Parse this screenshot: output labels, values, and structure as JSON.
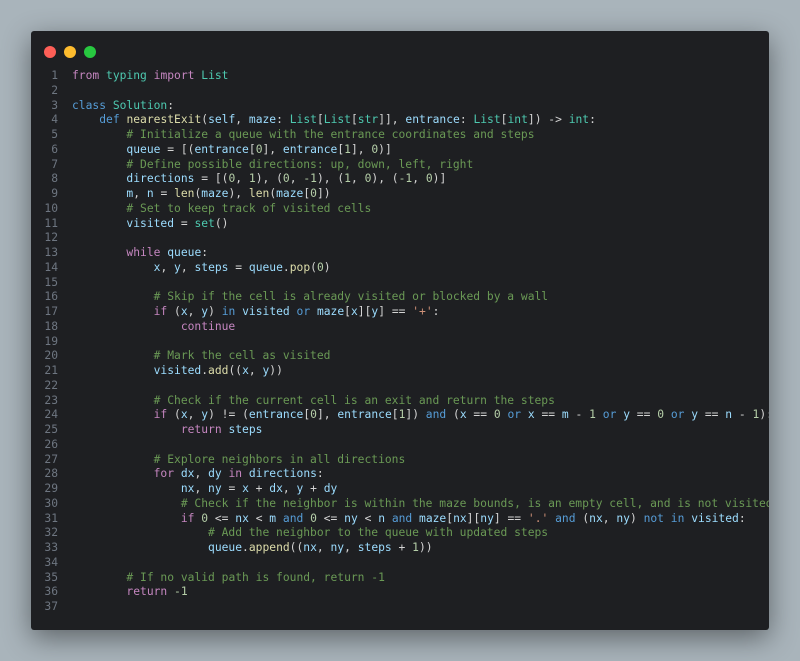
{
  "window": {
    "controls": [
      "close",
      "minimize",
      "maximize"
    ],
    "colors": {
      "close": "#fe5f57",
      "minimize": "#febc2e",
      "maximize": "#28c840",
      "background": "#1e1f22"
    }
  },
  "editor": {
    "language": "python",
    "lines": [
      {
        "n": "1",
        "t": [
          [
            "k",
            "from"
          ],
          [
            "p",
            " "
          ],
          [
            "c",
            "typing"
          ],
          [
            "p",
            " "
          ],
          [
            "k",
            "import"
          ],
          [
            "p",
            " "
          ],
          [
            "c",
            "List"
          ]
        ]
      },
      {
        "n": "2",
        "t": []
      },
      {
        "n": "3",
        "t": [
          [
            "d",
            "class"
          ],
          [
            "p",
            " "
          ],
          [
            "c",
            "Solution"
          ],
          [
            "p",
            ":"
          ]
        ]
      },
      {
        "n": "4",
        "t": [
          [
            "p",
            "    "
          ],
          [
            "d",
            "def"
          ],
          [
            "p",
            " "
          ],
          [
            "f",
            "nearestExit"
          ],
          [
            "p",
            "("
          ],
          [
            "v",
            "self"
          ],
          [
            "p",
            ", "
          ],
          [
            "v",
            "maze"
          ],
          [
            "p",
            ": "
          ],
          [
            "c",
            "List"
          ],
          [
            "p",
            "["
          ],
          [
            "c",
            "List"
          ],
          [
            "p",
            "["
          ],
          [
            "c",
            "str"
          ],
          [
            "p",
            "]], "
          ],
          [
            "v",
            "entrance"
          ],
          [
            "p",
            ": "
          ],
          [
            "c",
            "List"
          ],
          [
            "p",
            "["
          ],
          [
            "c",
            "int"
          ],
          [
            "p",
            "]) -> "
          ],
          [
            "c",
            "int"
          ],
          [
            "p",
            ":"
          ]
        ]
      },
      {
        "n": "5",
        "t": [
          [
            "p",
            "        "
          ],
          [
            "cm",
            "# Initialize a queue with the entrance coordinates and steps"
          ]
        ]
      },
      {
        "n": "6",
        "t": [
          [
            "p",
            "        "
          ],
          [
            "v",
            "queue"
          ],
          [
            "p",
            " = [("
          ],
          [
            "v",
            "entrance"
          ],
          [
            "p",
            "["
          ],
          [
            "n",
            "0"
          ],
          [
            "p",
            "], "
          ],
          [
            "v",
            "entrance"
          ],
          [
            "p",
            "["
          ],
          [
            "n",
            "1"
          ],
          [
            "p",
            "], "
          ],
          [
            "n",
            "0"
          ],
          [
            "p",
            ")]"
          ]
        ]
      },
      {
        "n": "7",
        "t": [
          [
            "p",
            "        "
          ],
          [
            "cm",
            "# Define possible directions: up, down, left, right"
          ]
        ]
      },
      {
        "n": "8",
        "t": [
          [
            "p",
            "        "
          ],
          [
            "v",
            "directions"
          ],
          [
            "p",
            " = [("
          ],
          [
            "n",
            "0"
          ],
          [
            "p",
            ", "
          ],
          [
            "n",
            "1"
          ],
          [
            "p",
            "), ("
          ],
          [
            "n",
            "0"
          ],
          [
            "p",
            ", "
          ],
          [
            "n",
            "-1"
          ],
          [
            "p",
            "), ("
          ],
          [
            "n",
            "1"
          ],
          [
            "p",
            ", "
          ],
          [
            "n",
            "0"
          ],
          [
            "p",
            "), ("
          ],
          [
            "n",
            "-1"
          ],
          [
            "p",
            ", "
          ],
          [
            "n",
            "0"
          ],
          [
            "p",
            ")]"
          ]
        ]
      },
      {
        "n": "9",
        "t": [
          [
            "p",
            "        "
          ],
          [
            "v",
            "m"
          ],
          [
            "p",
            ", "
          ],
          [
            "v",
            "n"
          ],
          [
            "p",
            " = "
          ],
          [
            "f",
            "len"
          ],
          [
            "p",
            "("
          ],
          [
            "v",
            "maze"
          ],
          [
            "p",
            "), "
          ],
          [
            "f",
            "len"
          ],
          [
            "p",
            "("
          ],
          [
            "v",
            "maze"
          ],
          [
            "p",
            "["
          ],
          [
            "n",
            "0"
          ],
          [
            "p",
            "])"
          ]
        ]
      },
      {
        "n": "10",
        "t": [
          [
            "p",
            "        "
          ],
          [
            "cm",
            "# Set to keep track of visited cells"
          ]
        ]
      },
      {
        "n": "11",
        "t": [
          [
            "p",
            "        "
          ],
          [
            "v",
            "visited"
          ],
          [
            "p",
            " = "
          ],
          [
            "c",
            "set"
          ],
          [
            "p",
            "()"
          ]
        ]
      },
      {
        "n": "12",
        "t": []
      },
      {
        "n": "13",
        "t": [
          [
            "p",
            "        "
          ],
          [
            "k",
            "while"
          ],
          [
            "p",
            " "
          ],
          [
            "v",
            "queue"
          ],
          [
            "p",
            ":"
          ]
        ]
      },
      {
        "n": "14",
        "t": [
          [
            "p",
            "            "
          ],
          [
            "v",
            "x"
          ],
          [
            "p",
            ", "
          ],
          [
            "v",
            "y"
          ],
          [
            "p",
            ", "
          ],
          [
            "v",
            "steps"
          ],
          [
            "p",
            " = "
          ],
          [
            "v",
            "queue"
          ],
          [
            "p",
            "."
          ],
          [
            "f",
            "pop"
          ],
          [
            "p",
            "("
          ],
          [
            "n",
            "0"
          ],
          [
            "p",
            ")"
          ]
        ]
      },
      {
        "n": "15",
        "t": []
      },
      {
        "n": "16",
        "t": [
          [
            "p",
            "            "
          ],
          [
            "cm",
            "# Skip if the cell is already visited or blocked by a wall"
          ]
        ]
      },
      {
        "n": "17",
        "t": [
          [
            "p",
            "            "
          ],
          [
            "k",
            "if"
          ],
          [
            "p",
            " ("
          ],
          [
            "v",
            "x"
          ],
          [
            "p",
            ", "
          ],
          [
            "v",
            "y"
          ],
          [
            "p",
            ") "
          ],
          [
            "d",
            "in"
          ],
          [
            "p",
            " "
          ],
          [
            "v",
            "visited"
          ],
          [
            "p",
            " "
          ],
          [
            "d",
            "or"
          ],
          [
            "p",
            " "
          ],
          [
            "v",
            "maze"
          ],
          [
            "p",
            "["
          ],
          [
            "v",
            "x"
          ],
          [
            "p",
            "]["
          ],
          [
            "v",
            "y"
          ],
          [
            "p",
            "] == "
          ],
          [
            "s",
            "'+'"
          ],
          [
            "p",
            ":"
          ]
        ]
      },
      {
        "n": "18",
        "t": [
          [
            "p",
            "                "
          ],
          [
            "k",
            "continue"
          ]
        ]
      },
      {
        "n": "19",
        "t": []
      },
      {
        "n": "20",
        "t": [
          [
            "p",
            "            "
          ],
          [
            "cm",
            "# Mark the cell as visited"
          ]
        ]
      },
      {
        "n": "21",
        "t": [
          [
            "p",
            "            "
          ],
          [
            "v",
            "visited"
          ],
          [
            "p",
            "."
          ],
          [
            "f",
            "add"
          ],
          [
            "p",
            "(("
          ],
          [
            "v",
            "x"
          ],
          [
            "p",
            ", "
          ],
          [
            "v",
            "y"
          ],
          [
            "p",
            "))"
          ]
        ]
      },
      {
        "n": "22",
        "t": []
      },
      {
        "n": "23",
        "t": [
          [
            "p",
            "            "
          ],
          [
            "cm",
            "# Check if the current cell is an exit and return the steps"
          ]
        ]
      },
      {
        "n": "24",
        "t": [
          [
            "p",
            "            "
          ],
          [
            "k",
            "if"
          ],
          [
            "p",
            " ("
          ],
          [
            "v",
            "x"
          ],
          [
            "p",
            ", "
          ],
          [
            "v",
            "y"
          ],
          [
            "p",
            ") != ("
          ],
          [
            "v",
            "entrance"
          ],
          [
            "p",
            "["
          ],
          [
            "n",
            "0"
          ],
          [
            "p",
            "], "
          ],
          [
            "v",
            "entrance"
          ],
          [
            "p",
            "["
          ],
          [
            "n",
            "1"
          ],
          [
            "p",
            "]) "
          ],
          [
            "d",
            "and"
          ],
          [
            "p",
            " ("
          ],
          [
            "v",
            "x"
          ],
          [
            "p",
            " == "
          ],
          [
            "n",
            "0"
          ],
          [
            "p",
            " "
          ],
          [
            "d",
            "or"
          ],
          [
            "p",
            " "
          ],
          [
            "v",
            "x"
          ],
          [
            "p",
            " == "
          ],
          [
            "v",
            "m"
          ],
          [
            "p",
            " - "
          ],
          [
            "n",
            "1"
          ],
          [
            "p",
            " "
          ],
          [
            "d",
            "or"
          ],
          [
            "p",
            " "
          ],
          [
            "v",
            "y"
          ],
          [
            "p",
            " == "
          ],
          [
            "n",
            "0"
          ],
          [
            "p",
            " "
          ],
          [
            "d",
            "or"
          ],
          [
            "p",
            " "
          ],
          [
            "v",
            "y"
          ],
          [
            "p",
            " == "
          ],
          [
            "v",
            "n"
          ],
          [
            "p",
            " - "
          ],
          [
            "n",
            "1"
          ],
          [
            "p",
            "):"
          ]
        ]
      },
      {
        "n": "25",
        "t": [
          [
            "p",
            "                "
          ],
          [
            "k",
            "return"
          ],
          [
            "p",
            " "
          ],
          [
            "v",
            "steps"
          ]
        ]
      },
      {
        "n": "26",
        "t": []
      },
      {
        "n": "27",
        "t": [
          [
            "p",
            "            "
          ],
          [
            "cm",
            "# Explore neighbors in all directions"
          ]
        ]
      },
      {
        "n": "28",
        "t": [
          [
            "p",
            "            "
          ],
          [
            "k",
            "for"
          ],
          [
            "p",
            " "
          ],
          [
            "v",
            "dx"
          ],
          [
            "p",
            ", "
          ],
          [
            "v",
            "dy"
          ],
          [
            "p",
            " "
          ],
          [
            "k",
            "in"
          ],
          [
            "p",
            " "
          ],
          [
            "v",
            "directions"
          ],
          [
            "p",
            ":"
          ]
        ]
      },
      {
        "n": "29",
        "t": [
          [
            "p",
            "                "
          ],
          [
            "v",
            "nx"
          ],
          [
            "p",
            ", "
          ],
          [
            "v",
            "ny"
          ],
          [
            "p",
            " = "
          ],
          [
            "v",
            "x"
          ],
          [
            "p",
            " + "
          ],
          [
            "v",
            "dx"
          ],
          [
            "p",
            ", "
          ],
          [
            "v",
            "y"
          ],
          [
            "p",
            " + "
          ],
          [
            "v",
            "dy"
          ]
        ]
      },
      {
        "n": "30",
        "t": [
          [
            "p",
            "                "
          ],
          [
            "cm",
            "# Check if the neighbor is within the maze bounds, is an empty cell, and is not visited"
          ]
        ]
      },
      {
        "n": "31",
        "t": [
          [
            "p",
            "                "
          ],
          [
            "k",
            "if"
          ],
          [
            "p",
            " "
          ],
          [
            "n",
            "0"
          ],
          [
            "p",
            " <= "
          ],
          [
            "v",
            "nx"
          ],
          [
            "p",
            " < "
          ],
          [
            "v",
            "m"
          ],
          [
            "p",
            " "
          ],
          [
            "d",
            "and"
          ],
          [
            "p",
            " "
          ],
          [
            "n",
            "0"
          ],
          [
            "p",
            " <= "
          ],
          [
            "v",
            "ny"
          ],
          [
            "p",
            " < "
          ],
          [
            "v",
            "n"
          ],
          [
            "p",
            " "
          ],
          [
            "d",
            "and"
          ],
          [
            "p",
            " "
          ],
          [
            "v",
            "maze"
          ],
          [
            "p",
            "["
          ],
          [
            "v",
            "nx"
          ],
          [
            "p",
            "]["
          ],
          [
            "v",
            "ny"
          ],
          [
            "p",
            "] == "
          ],
          [
            "s",
            "'.'"
          ],
          [
            "p",
            " "
          ],
          [
            "d",
            "and"
          ],
          [
            "p",
            " ("
          ],
          [
            "v",
            "nx"
          ],
          [
            "p",
            ", "
          ],
          [
            "v",
            "ny"
          ],
          [
            "p",
            ") "
          ],
          [
            "d",
            "not"
          ],
          [
            "p",
            " "
          ],
          [
            "d",
            "in"
          ],
          [
            "p",
            " "
          ],
          [
            "v",
            "visited"
          ],
          [
            "p",
            ":"
          ]
        ]
      },
      {
        "n": "32",
        "t": [
          [
            "p",
            "                    "
          ],
          [
            "cm",
            "# Add the neighbor to the queue with updated steps"
          ]
        ]
      },
      {
        "n": "33",
        "t": [
          [
            "p",
            "                    "
          ],
          [
            "v",
            "queue"
          ],
          [
            "p",
            "."
          ],
          [
            "f",
            "append"
          ],
          [
            "p",
            "(("
          ],
          [
            "v",
            "nx"
          ],
          [
            "p",
            ", "
          ],
          [
            "v",
            "ny"
          ],
          [
            "p",
            ", "
          ],
          [
            "v",
            "steps"
          ],
          [
            "p",
            " + "
          ],
          [
            "n",
            "1"
          ],
          [
            "p",
            "))"
          ]
        ]
      },
      {
        "n": "34",
        "t": []
      },
      {
        "n": "35",
        "t": [
          [
            "p",
            "        "
          ],
          [
            "cm",
            "# If no valid path is found, return -1"
          ]
        ]
      },
      {
        "n": "36",
        "t": [
          [
            "p",
            "        "
          ],
          [
            "k",
            "return"
          ],
          [
            "p",
            " "
          ],
          [
            "n",
            "-1"
          ]
        ]
      },
      {
        "n": "37",
        "t": []
      }
    ]
  }
}
